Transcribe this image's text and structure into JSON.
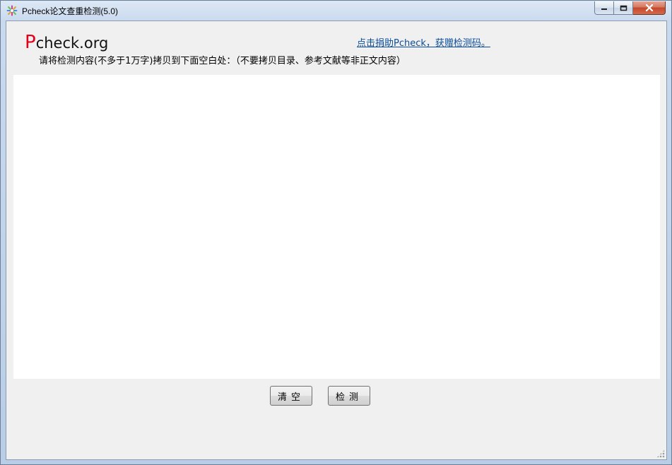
{
  "window": {
    "title": "Pcheck论文查重检测(5.0)",
    "icons": {
      "app": "pcheck-app-icon",
      "minimize": "minimize-icon",
      "maximize": "maximize-icon",
      "close": "close-icon"
    }
  },
  "header": {
    "logo_first": "P",
    "logo_rest": "check.org",
    "donate_link": "点击捐助Pcheck，获赠检测码。",
    "instruction": "请将检测内容(不多于1万字)拷贝到下面空白处：（不要拷贝目录、参考文献等非正文内容）"
  },
  "editor": {
    "value": "",
    "placeholder": ""
  },
  "buttons": {
    "clear": "清空",
    "check": "检测"
  },
  "colors": {
    "logo_accent": "#e3001b",
    "link": "#0b4d9a",
    "client_bg": "#f0f0f0"
  }
}
